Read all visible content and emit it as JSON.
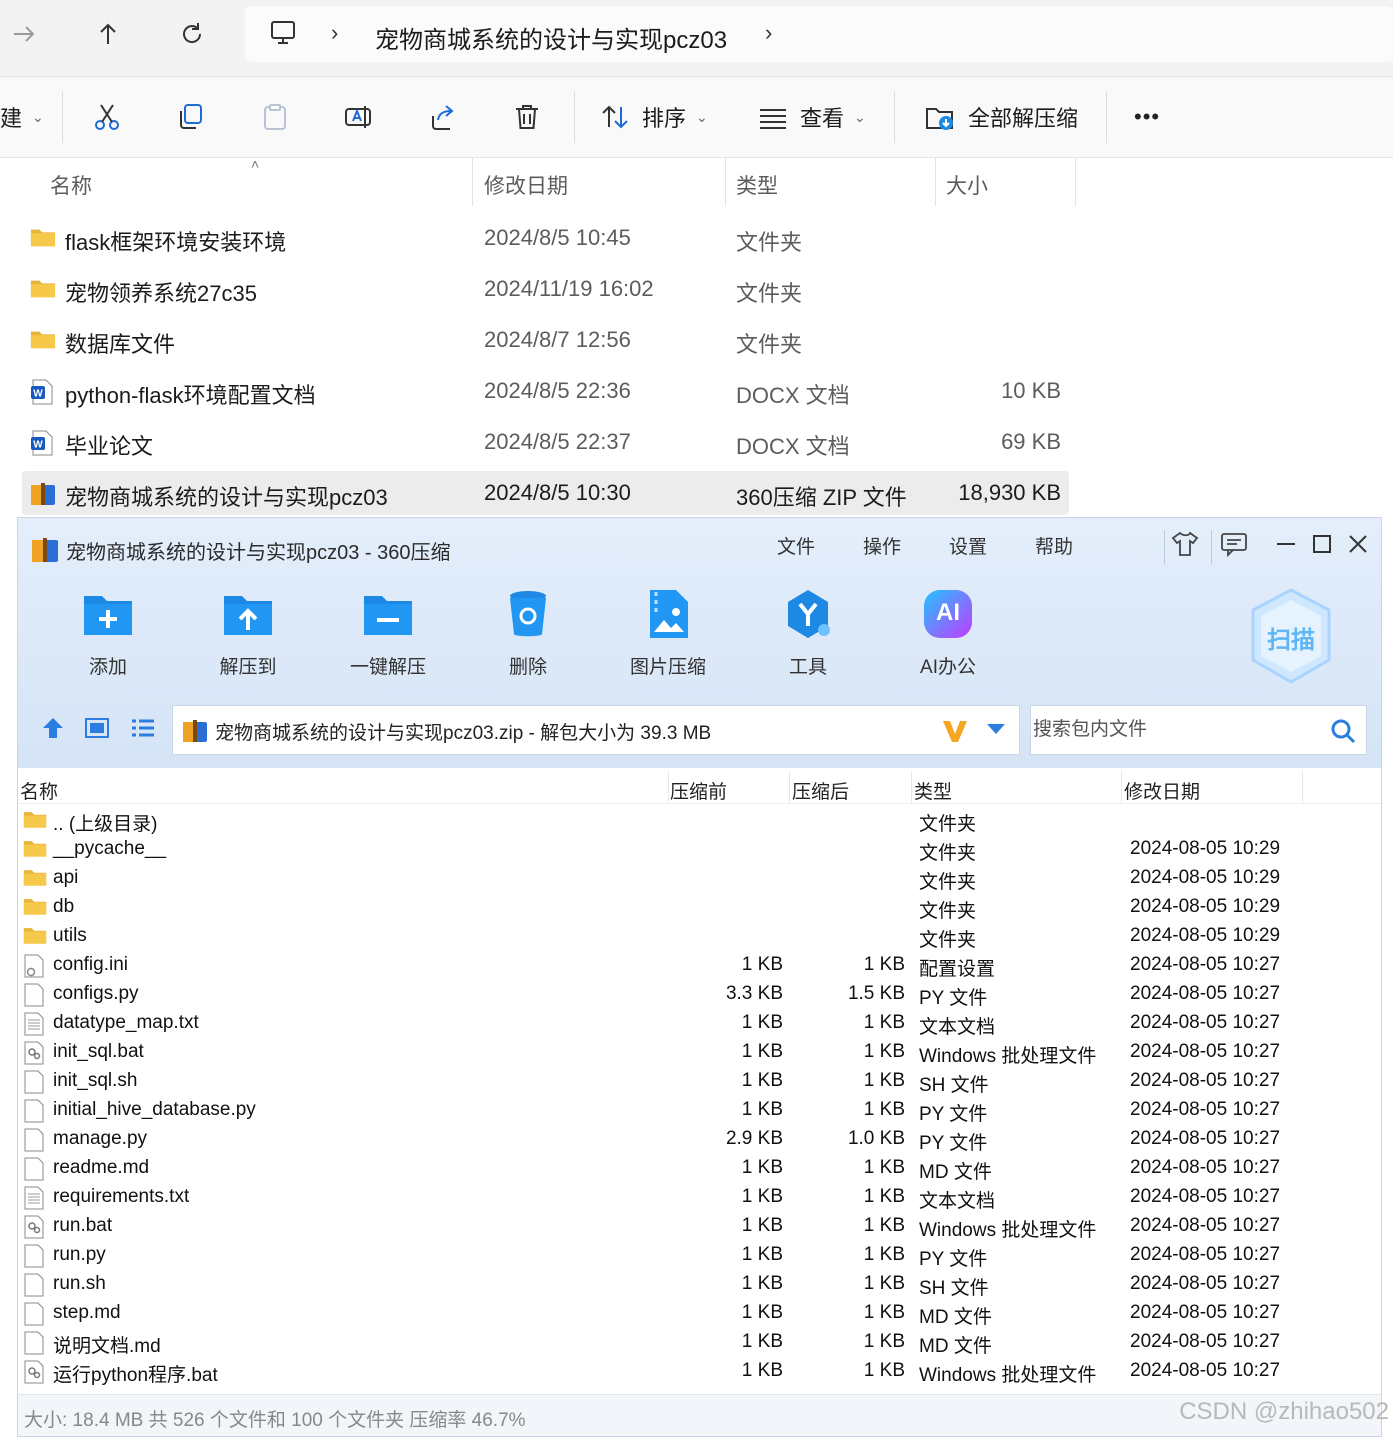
{
  "explorer": {
    "breadcrumb": "宠物商城系统的设计与实现pcz03",
    "toolbar": {
      "new_label": "建",
      "sort_label": "排序",
      "view_label": "查看",
      "extract_all_label": "全部解压缩",
      "more_label": "•••"
    },
    "columns": {
      "name": "名称",
      "date": "修改日期",
      "type": "类型",
      "size": "大小"
    },
    "rows": [
      {
        "name": "flask框架环境安装环境",
        "date": "2024/8/5 10:45",
        "type": "文件夹",
        "size": "",
        "icon": "folder-icon"
      },
      {
        "name": "宠物领养系统27c35",
        "date": "2024/11/19 16:02",
        "type": "文件夹",
        "size": "",
        "icon": "folder-icon"
      },
      {
        "name": "数据库文件",
        "date": "2024/8/7 12:56",
        "type": "文件夹",
        "size": "",
        "icon": "folder-icon"
      },
      {
        "name": "python-flask环境配置文档",
        "date": "2024/8/5 22:36",
        "type": "DOCX 文档",
        "size": "10 KB",
        "icon": "word-icon"
      },
      {
        "name": "毕业论文",
        "date": "2024/8/5 22:37",
        "type": "DOCX 文档",
        "size": "69 KB",
        "icon": "word-icon"
      },
      {
        "name": "宠物商城系统的设计与实现pcz03",
        "date": "2024/8/5 10:30",
        "type": "360压缩 ZIP 文件",
        "size": "18,930 KB",
        "icon": "zip-icon",
        "selected": true
      }
    ]
  },
  "zipwin": {
    "title": "宠物商城系统的设计与实现pcz03 - 360压缩",
    "menu": [
      "文件",
      "操作",
      "设置",
      "帮助"
    ],
    "buttons": [
      {
        "label": "添加",
        "icon": "add-folder-icon"
      },
      {
        "label": "解压到",
        "icon": "extract-to-icon"
      },
      {
        "label": "一键解压",
        "icon": "one-click-extract-icon"
      },
      {
        "label": "删除",
        "icon": "delete-bin-icon"
      },
      {
        "label": "图片压缩",
        "icon": "image-compress-icon"
      },
      {
        "label": "工具",
        "icon": "tools-icon"
      },
      {
        "label": "AI办公",
        "icon": "ai-office-icon"
      }
    ],
    "scan_label": "扫描",
    "ai_badge": "AI",
    "path_text": "宠物商城系统的设计与实现pcz03.zip - 解包大小为 39.3 MB",
    "search_placeholder": "搜索包内文件",
    "columns": {
      "name": "名称",
      "before": "压缩前",
      "after": "压缩后",
      "type": "类型",
      "date": "修改日期"
    },
    "rows": [
      {
        "name": ".. (上级目录)",
        "before": "",
        "after": "",
        "type": "文件夹",
        "date": "",
        "icon": "folder"
      },
      {
        "name": "__pycache__",
        "before": "",
        "after": "",
        "type": "文件夹",
        "date": "2024-08-05 10:29",
        "icon": "folder"
      },
      {
        "name": "api",
        "before": "",
        "after": "",
        "type": "文件夹",
        "date": "2024-08-05 10:29",
        "icon": "folder"
      },
      {
        "name": "db",
        "before": "",
        "after": "",
        "type": "文件夹",
        "date": "2024-08-05 10:29",
        "icon": "folder"
      },
      {
        "name": "utils",
        "before": "",
        "after": "",
        "type": "文件夹",
        "date": "2024-08-05 10:29",
        "icon": "folder"
      },
      {
        "name": "config.ini",
        "before": "1 KB",
        "after": "1 KB",
        "type": "配置设置",
        "date": "2024-08-05 10:27",
        "icon": "config"
      },
      {
        "name": "configs.py",
        "before": "3.3 KB",
        "after": "1.5 KB",
        "type": "PY 文件",
        "date": "2024-08-05 10:27",
        "icon": "file"
      },
      {
        "name": "datatype_map.txt",
        "before": "1 KB",
        "after": "1 KB",
        "type": "文本文档",
        "date": "2024-08-05 10:27",
        "icon": "text"
      },
      {
        "name": "init_sql.bat",
        "before": "1 KB",
        "after": "1 KB",
        "type": "Windows 批处理文件",
        "date": "2024-08-05 10:27",
        "icon": "bat"
      },
      {
        "name": "init_sql.sh",
        "before": "1 KB",
        "after": "1 KB",
        "type": "SH 文件",
        "date": "2024-08-05 10:27",
        "icon": "file"
      },
      {
        "name": "initial_hive_database.py",
        "before": "1 KB",
        "after": "1 KB",
        "type": "PY 文件",
        "date": "2024-08-05 10:27",
        "icon": "file"
      },
      {
        "name": "manage.py",
        "before": "2.9 KB",
        "after": "1.0 KB",
        "type": "PY 文件",
        "date": "2024-08-05 10:27",
        "icon": "file"
      },
      {
        "name": "readme.md",
        "before": "1 KB",
        "after": "1 KB",
        "type": "MD 文件",
        "date": "2024-08-05 10:27",
        "icon": "file"
      },
      {
        "name": "requirements.txt",
        "before": "1 KB",
        "after": "1 KB",
        "type": "文本文档",
        "date": "2024-08-05 10:27",
        "icon": "text"
      },
      {
        "name": "run.bat",
        "before": "1 KB",
        "after": "1 KB",
        "type": "Windows 批处理文件",
        "date": "2024-08-05 10:27",
        "icon": "bat"
      },
      {
        "name": "run.py",
        "before": "1 KB",
        "after": "1 KB",
        "type": "PY 文件",
        "date": "2024-08-05 10:27",
        "icon": "file"
      },
      {
        "name": "run.sh",
        "before": "1 KB",
        "after": "1 KB",
        "type": "SH 文件",
        "date": "2024-08-05 10:27",
        "icon": "file"
      },
      {
        "name": "step.md",
        "before": "1 KB",
        "after": "1 KB",
        "type": "MD 文件",
        "date": "2024-08-05 10:27",
        "icon": "file"
      },
      {
        "name": "说明文档.md",
        "before": "1 KB",
        "after": "1 KB",
        "type": "MD 文件",
        "date": "2024-08-05 10:27",
        "icon": "file"
      },
      {
        "name": "运行python程序.bat",
        "before": "1 KB",
        "after": "1 KB",
        "type": "Windows 批处理文件",
        "date": "2024-08-05 10:27",
        "icon": "bat"
      }
    ],
    "status": "大小: 18.4 MB 共 526 个文件和 100 个文件夹 压缩率 46.7%"
  },
  "watermark": "CSDN @zhihao502",
  "colors": {
    "accent": "#1e88e5",
    "folder": "#f7c94a",
    "selected_row": "#ececec",
    "word": "#185abd"
  }
}
